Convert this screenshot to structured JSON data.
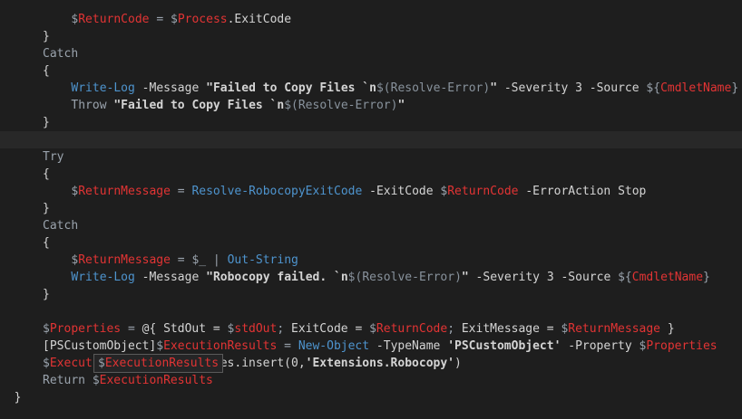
{
  "code_lines": [
    {
      "indent": 10,
      "current": false,
      "tokens": [
        [
          "dol",
          "$"
        ],
        [
          "var",
          "ReturnCode"
        ],
        [
          "op",
          " = "
        ],
        [
          "dol",
          "$"
        ],
        [
          "var",
          "Process"
        ],
        [
          "plain",
          ".ExitCode"
        ]
      ]
    },
    {
      "indent": 6,
      "current": false,
      "tokens": [
        [
          "plain",
          "}"
        ]
      ]
    },
    {
      "indent": 6,
      "current": false,
      "tokens": [
        [
          "kw",
          "Catch"
        ]
      ]
    },
    {
      "indent": 6,
      "current": false,
      "tokens": [
        [
          "plain",
          "{"
        ]
      ]
    },
    {
      "indent": 10,
      "current": false,
      "tokens": [
        [
          "cmd",
          "Write-Log"
        ],
        [
          "par",
          " -Message "
        ],
        [
          "str",
          "\"Failed to Copy Files `n"
        ],
        [
          "sub",
          "$(Resolve-Error)"
        ],
        [
          "str",
          "\""
        ],
        [
          "par",
          " -Severity 3 -Source "
        ],
        [
          "dol",
          "${"
        ],
        [
          "var",
          "CmdletName"
        ],
        [
          "dol",
          "}"
        ]
      ]
    },
    {
      "indent": 10,
      "current": false,
      "tokens": [
        [
          "kw",
          "Throw"
        ],
        [
          "str",
          " \"Failed to Copy Files `n"
        ],
        [
          "sub",
          "$(Resolve-Error)"
        ],
        [
          "str",
          "\""
        ]
      ]
    },
    {
      "indent": 6,
      "current": false,
      "tokens": [
        [
          "plain",
          "}"
        ]
      ]
    },
    {
      "indent": 0,
      "current": true,
      "tokens": []
    },
    {
      "indent": 6,
      "current": false,
      "tokens": [
        [
          "kw",
          "Try"
        ]
      ]
    },
    {
      "indent": 6,
      "current": false,
      "tokens": [
        [
          "plain",
          "{"
        ]
      ]
    },
    {
      "indent": 10,
      "current": false,
      "tokens": [
        [
          "dol",
          "$"
        ],
        [
          "var",
          "ReturnMessage"
        ],
        [
          "op",
          " = "
        ],
        [
          "cmd",
          "Resolve-RobocopyExitCode"
        ],
        [
          "par",
          " -ExitCode "
        ],
        [
          "dol",
          "$"
        ],
        [
          "var",
          "ReturnCode"
        ],
        [
          "par",
          " -ErrorAction Stop"
        ]
      ]
    },
    {
      "indent": 6,
      "current": false,
      "tokens": [
        [
          "plain",
          "}"
        ]
      ]
    },
    {
      "indent": 6,
      "current": false,
      "tokens": [
        [
          "kw",
          "Catch"
        ]
      ]
    },
    {
      "indent": 6,
      "current": false,
      "tokens": [
        [
          "plain",
          "{"
        ]
      ]
    },
    {
      "indent": 10,
      "current": false,
      "tokens": [
        [
          "dol",
          "$"
        ],
        [
          "var",
          "ReturnMessage"
        ],
        [
          "op",
          " = "
        ],
        [
          "dol",
          "$_"
        ],
        [
          "op",
          " | "
        ],
        [
          "cmd",
          "Out-String"
        ]
      ]
    },
    {
      "indent": 10,
      "current": false,
      "tokens": [
        [
          "cmd",
          "Write-Log"
        ],
        [
          "par",
          " -Message "
        ],
        [
          "str",
          "\"Robocopy failed. `n"
        ],
        [
          "sub",
          "$(Resolve-Error)"
        ],
        [
          "str",
          "\""
        ],
        [
          "par",
          " -Severity 3 -Source "
        ],
        [
          "dol",
          "${"
        ],
        [
          "var",
          "CmdletName"
        ],
        [
          "dol",
          "}"
        ]
      ]
    },
    {
      "indent": 6,
      "current": false,
      "tokens": [
        [
          "plain",
          "}"
        ]
      ]
    },
    {
      "indent": 0,
      "current": false,
      "tokens": []
    },
    {
      "indent": 6,
      "current": false,
      "tokens": [
        [
          "dol",
          "$"
        ],
        [
          "var",
          "Properties"
        ],
        [
          "op",
          " = "
        ],
        [
          "plain",
          "@{ StdOut = "
        ],
        [
          "dol",
          "$"
        ],
        [
          "var",
          "stdOut"
        ],
        [
          "op",
          "; "
        ],
        [
          "plain",
          "ExitCode = "
        ],
        [
          "dol",
          "$"
        ],
        [
          "var",
          "ReturnCode"
        ],
        [
          "op",
          "; "
        ],
        [
          "plain",
          "ExitMessage = "
        ],
        [
          "dol",
          "$"
        ],
        [
          "var",
          "ReturnMessage"
        ],
        [
          "plain",
          " }"
        ]
      ]
    },
    {
      "indent": 6,
      "current": false,
      "tokens": [
        [
          "plain",
          "[PSCustomObject]"
        ],
        [
          "dol",
          "$"
        ],
        [
          "var",
          "ExecutionResults"
        ],
        [
          "op",
          " = "
        ],
        [
          "cmd",
          "New-Object"
        ],
        [
          "par",
          " -TypeName "
        ],
        [
          "str",
          "'PSCustomObject'"
        ],
        [
          "par",
          " -Property "
        ],
        [
          "dol",
          "$"
        ],
        [
          "var",
          "Properties"
        ]
      ]
    },
    {
      "indent": 6,
      "current": false,
      "tokens": [
        [
          "dol",
          "$"
        ],
        [
          "var",
          "Execut"
        ],
        [
          "plain",
          "                 mes.insert("
        ],
        [
          "plain",
          "0"
        ],
        [
          "plain",
          ","
        ],
        [
          "str",
          "'Extensions.Robocopy'"
        ],
        [
          "plain",
          ")"
        ]
      ]
    },
    {
      "indent": 6,
      "current": false,
      "tokens": [
        [
          "kw",
          "Return "
        ],
        [
          "dol",
          "$"
        ],
        [
          "var",
          "ExecutionResults"
        ]
      ]
    },
    {
      "indent": 2,
      "current": false,
      "tokens": [
        [
          "plain",
          "}"
        ]
      ]
    }
  ],
  "tooltip": {
    "prefix": "$",
    "name": "ExecutionResults"
  }
}
